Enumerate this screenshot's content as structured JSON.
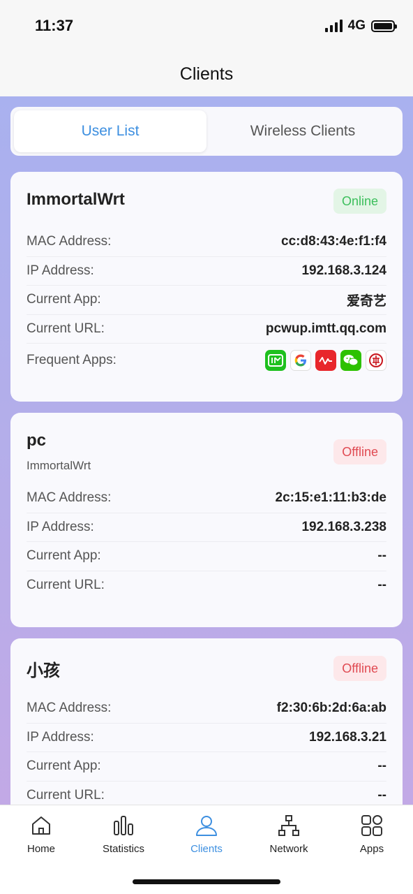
{
  "status_bar": {
    "time": "11:37",
    "network": "4G"
  },
  "header": {
    "title": "Clients"
  },
  "tabs": {
    "user_list": "User List",
    "wireless_clients": "Wireless Clients"
  },
  "labels": {
    "mac": "MAC Address:",
    "ip": "IP Address:",
    "app": "Current App:",
    "url": "Current URL:",
    "frequent_apps": "Frequent Apps:"
  },
  "clients": [
    {
      "name": "ImmortalWrt",
      "status": "Online",
      "mac": "cc:d8:43:4e:f1:f4",
      "ip": "192.168.3.124",
      "app": "爱奇艺",
      "url": "pcwup.imtt.qq.com",
      "frequent_apps": [
        "iqiyi-icon",
        "google-icon",
        "stock-chart-icon",
        "wechat-icon",
        "bank-icon"
      ]
    },
    {
      "name": "pc",
      "subtitle": "ImmortalWrt",
      "status": "Offline",
      "mac": "2c:15:e1:11:b3:de",
      "ip": "192.168.3.238",
      "app": "--",
      "url": "--"
    },
    {
      "name": "小孩",
      "status": "Offline",
      "mac": "f2:30:6b:2d:6a:ab",
      "ip": "192.168.3.21",
      "app": "--",
      "url": "--"
    }
  ],
  "tab_bar": {
    "home": "Home",
    "statistics": "Statistics",
    "clients": "Clients",
    "network": "Network",
    "apps": "Apps"
  },
  "colors": {
    "accent": "#3d8fe0",
    "online_text": "#3cbf5c",
    "offline_text": "#e04a52",
    "gradient_top": "#a9b1ef",
    "gradient_bottom": "#c2a9e6"
  }
}
